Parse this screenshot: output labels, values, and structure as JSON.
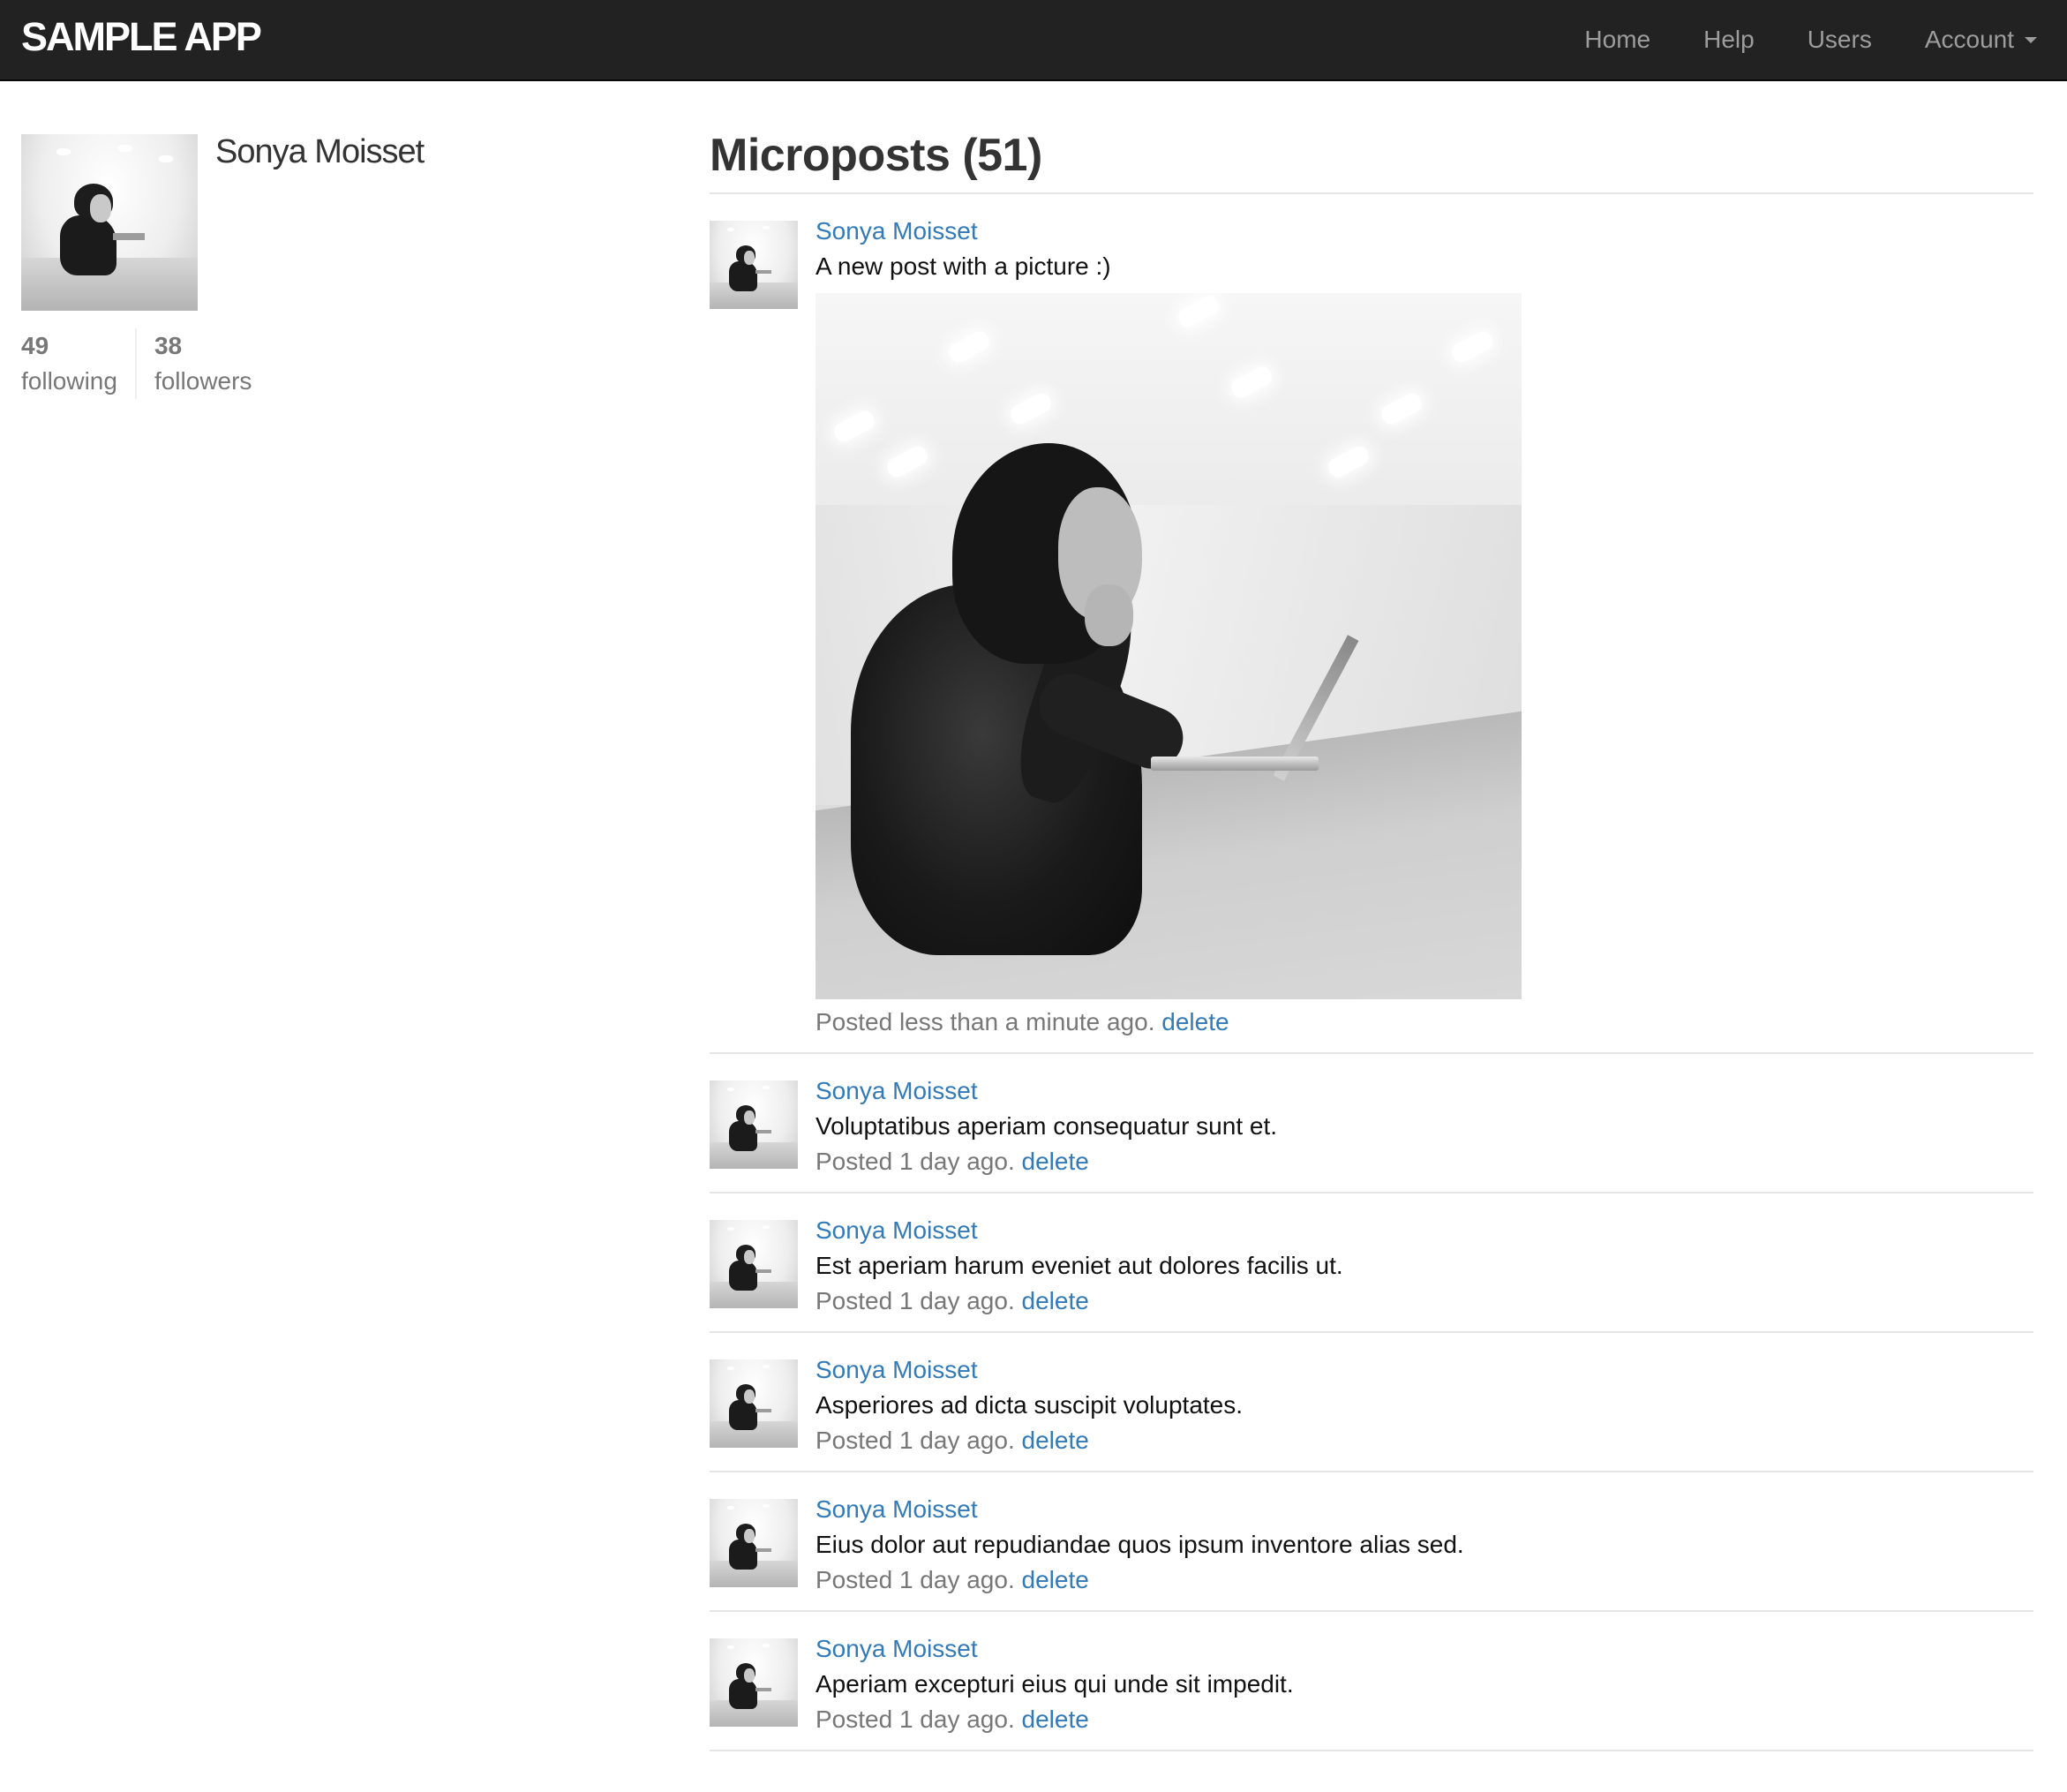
{
  "app": {
    "logo": "SAMPLE APP",
    "nav": {
      "home": "Home",
      "help": "Help",
      "users": "Users",
      "account": "Account"
    }
  },
  "profile": {
    "name": "Sonya Moisset",
    "stats": {
      "following_count": "49",
      "following_label": "following",
      "followers_count": "38",
      "followers_label": "followers"
    }
  },
  "feed": {
    "title": "Microposts (51)",
    "delete_label": "delete",
    "posts": [
      {
        "user": "Sonya Moisset",
        "content": "A new post with a picture :)",
        "has_picture": true,
        "timestamp": "Posted less than a minute ago."
      },
      {
        "user": "Sonya Moisset",
        "content": "Voluptatibus aperiam consequatur sunt et.",
        "timestamp": "Posted 1 day ago."
      },
      {
        "user": "Sonya Moisset",
        "content": "Est aperiam harum eveniet aut dolores facilis ut.",
        "timestamp": "Posted 1 day ago."
      },
      {
        "user": "Sonya Moisset",
        "content": "Asperiores ad dicta suscipit voluptates.",
        "timestamp": "Posted 1 day ago."
      },
      {
        "user": "Sonya Moisset",
        "content": "Eius dolor aut repudiandae quos ipsum inventore alias sed.",
        "timestamp": "Posted 1 day ago."
      },
      {
        "user": "Sonya Moisset",
        "content": "Aperiam excepturi eius qui unde sit impedit.",
        "timestamp": "Posted 1 day ago."
      }
    ]
  },
  "colors": {
    "navbar_bg": "#222222",
    "nav_link": "#9d9d9d",
    "link": "#337ab7",
    "muted": "#777777"
  }
}
